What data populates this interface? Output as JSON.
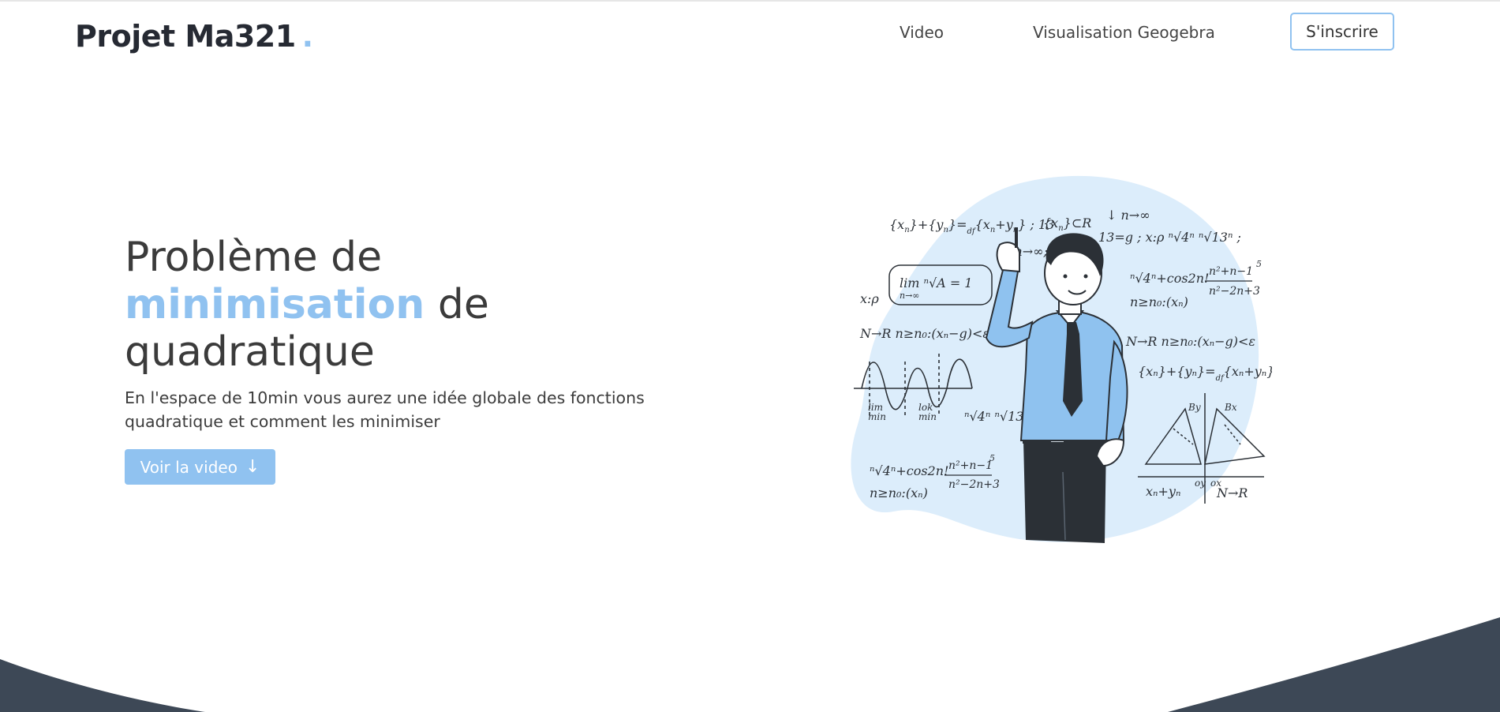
{
  "header": {
    "logo_text": "Projet Ma321",
    "logo_dot": ".",
    "nav": {
      "video": "Video",
      "geogebra": "Visualisation Geogebra"
    },
    "signup_label": "S'inscrire"
  },
  "hero": {
    "title_part1": "Problème de",
    "title_accent": "minimisation",
    "title_part2": "de",
    "title_part3": "quadratique",
    "description": "En l'espace de 10min vous aurez une idée globale des fonctions quadratique et comment les minimiser",
    "cta_label": "Voir la video",
    "cta_icon": "arrow-down-icon"
  },
  "colors": {
    "accent": "#90c2f0",
    "dark": "#3d4856",
    "blob": "#dcedfb"
  }
}
